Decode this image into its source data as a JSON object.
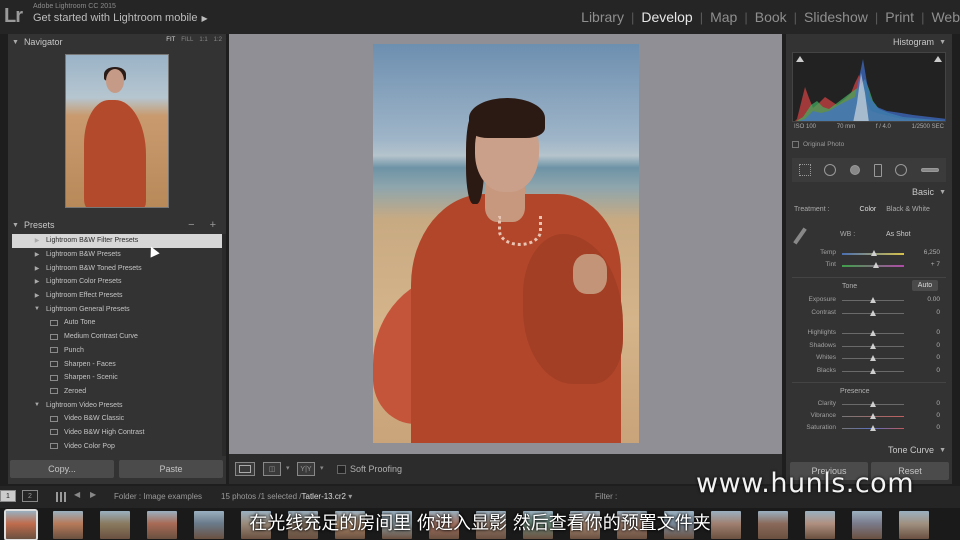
{
  "app": {
    "logo": "Lr",
    "name": "Adobe Lightroom CC 2015",
    "identity": "Get started with Lightroom mobile",
    "identity_arrow": "▶"
  },
  "modules": [
    {
      "label": "Library",
      "active": false
    },
    {
      "label": "Develop",
      "active": true
    },
    {
      "label": "Map",
      "active": false
    },
    {
      "label": "Book",
      "active": false
    },
    {
      "label": "Slideshow",
      "active": false
    },
    {
      "label": "Print",
      "active": false
    },
    {
      "label": "Web",
      "active": false
    }
  ],
  "navigator": {
    "title": "Navigator",
    "zoom_options": [
      "FIT",
      "FILL",
      "1:1",
      "1:2"
    ]
  },
  "presets": {
    "title": "Presets",
    "controls": "− +",
    "items": [
      {
        "label": "Lightroom B&W Filter Presets",
        "type": "folder",
        "expanded": false,
        "selected": true
      },
      {
        "label": "Lightroom B&W Presets",
        "type": "folder",
        "expanded": false
      },
      {
        "label": "Lightroom B&W Toned Presets",
        "type": "folder",
        "expanded": false
      },
      {
        "label": "Lightroom Color Presets",
        "type": "folder",
        "expanded": false
      },
      {
        "label": "Lightroom Effect Presets",
        "type": "folder",
        "expanded": false
      },
      {
        "label": "Lightroom General Presets",
        "type": "folder",
        "expanded": true
      },
      {
        "label": "Auto Tone",
        "type": "item"
      },
      {
        "label": "Medium Contrast Curve",
        "type": "item"
      },
      {
        "label": "Punch",
        "type": "item"
      },
      {
        "label": "Sharpen - Faces",
        "type": "item"
      },
      {
        "label": "Sharpen - Scenic",
        "type": "item"
      },
      {
        "label": "Zeroed",
        "type": "item"
      },
      {
        "label": "Lightroom Video Presets",
        "type": "folder",
        "expanded": true
      },
      {
        "label": "Video B&W Classic",
        "type": "item"
      },
      {
        "label": "Video B&W High Contrast",
        "type": "item"
      },
      {
        "label": "Video Color Pop",
        "type": "item"
      }
    ]
  },
  "left_buttons": {
    "copy": "Copy...",
    "paste": "Paste"
  },
  "toolbar": {
    "soft_proofing": "Soft Proofing",
    "caret": "▾"
  },
  "histogram": {
    "title": "Histogram",
    "iso": "ISO 100",
    "focal": "70 mm",
    "aperture": "f / 4.0",
    "shutter": "1/2500 SEC",
    "original_photo": "Original Photo"
  },
  "basic": {
    "title": "Basic",
    "treatment_label": "Treatment :",
    "treatment_color": "Color",
    "treatment_bw": "Black & White",
    "wb_label": "WB :",
    "wb_value": "As Shot",
    "temp": {
      "label": "Temp",
      "value": "6,250",
      "level": 0.52
    },
    "tint": {
      "label": "Tint",
      "value": "+ 7",
      "level": 0.55
    },
    "tone_label": "Tone",
    "auto_label": "Auto",
    "exposure": {
      "label": "Exposure",
      "value": "0.00",
      "level": 0.5
    },
    "contrast": {
      "label": "Contrast",
      "value": "0",
      "level": 0.5
    },
    "highlights": {
      "label": "Highlights",
      "value": "0",
      "level": 0.5
    },
    "shadows": {
      "label": "Shadows",
      "value": "0",
      "level": 0.5
    },
    "whites": {
      "label": "Whites",
      "value": "0",
      "level": 0.5
    },
    "blacks": {
      "label": "Blacks",
      "value": "0",
      "level": 0.5
    },
    "presence_label": "Presence",
    "clarity": {
      "label": "Clarity",
      "value": "0",
      "level": 0.5
    },
    "vibrance": {
      "label": "Vibrance",
      "value": "0",
      "level": 0.5
    },
    "saturation": {
      "label": "Saturation",
      "value": "0",
      "level": 0.5
    }
  },
  "tone_curve": {
    "title": "Tone Curve"
  },
  "right_buttons": {
    "previous": "Previous",
    "reset": "Reset"
  },
  "filmstrip_bar": {
    "page1": "1",
    "page2": "2",
    "folder": "Folder : Image examples",
    "count": "15 photos /1 selected /",
    "filename": "Tatler-13.cr2",
    "filter": "Filter :"
  },
  "watermark": "www.hunls.com",
  "subtitle": "在光线充足的房间里  你进入显影  然后查看你的预置文件夹"
}
